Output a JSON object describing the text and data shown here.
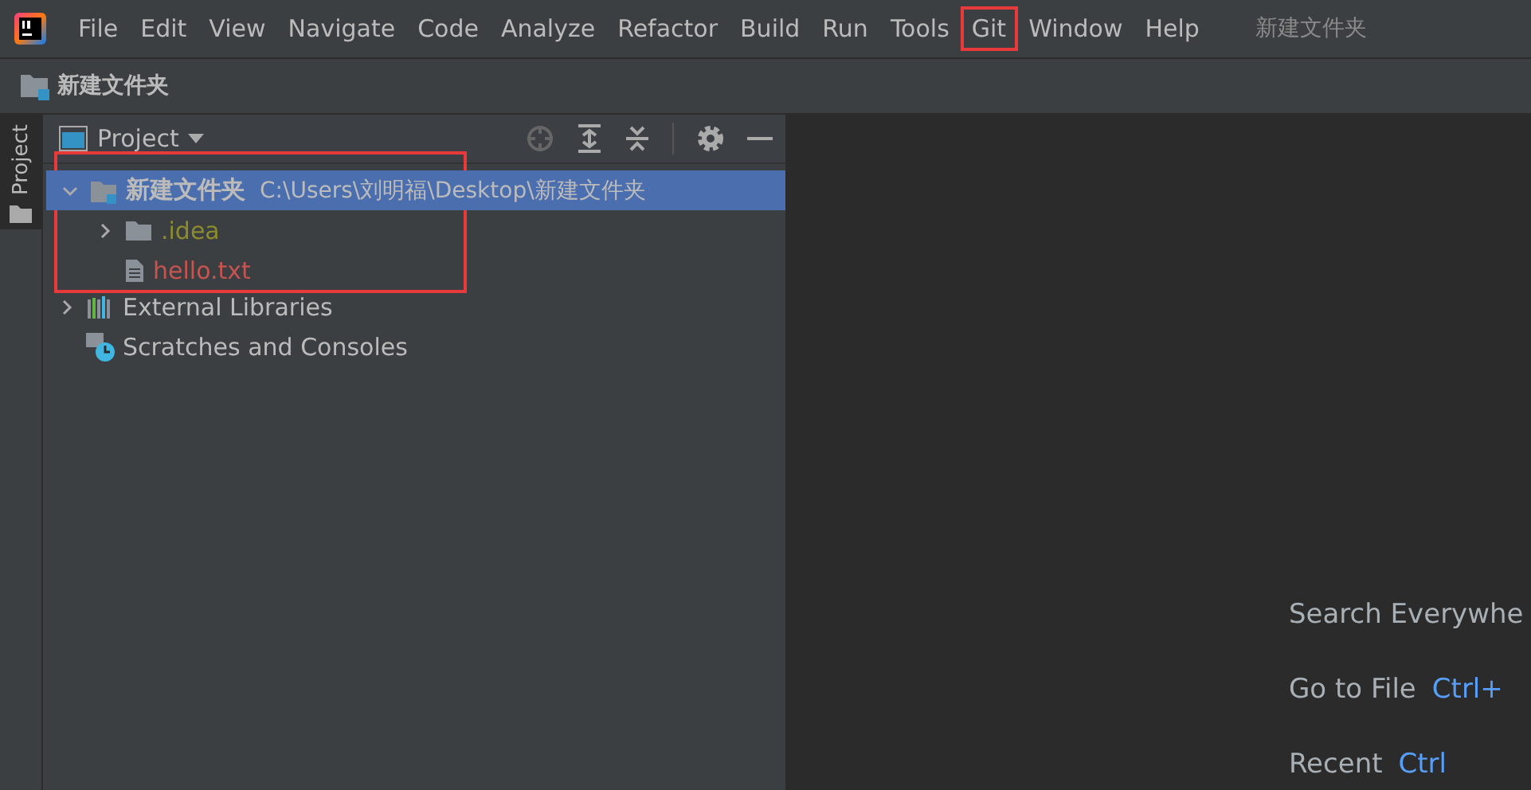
{
  "menu_bar": {
    "items": [
      {
        "label": "File",
        "highlighted": false
      },
      {
        "label": "Edit",
        "highlighted": false
      },
      {
        "label": "View",
        "highlighted": false
      },
      {
        "label": "Navigate",
        "highlighted": false
      },
      {
        "label": "Code",
        "highlighted": false
      },
      {
        "label": "Analyze",
        "highlighted": false
      },
      {
        "label": "Refactor",
        "highlighted": false
      },
      {
        "label": "Build",
        "highlighted": false
      },
      {
        "label": "Run",
        "highlighted": false
      },
      {
        "label": "Tools",
        "highlighted": false
      },
      {
        "label": "Git",
        "highlighted": true
      },
      {
        "label": "Window",
        "highlighted": false
      },
      {
        "label": "Help",
        "highlighted": false
      }
    ],
    "project_title": "新建文件夹"
  },
  "breadcrumb": "新建文件夹",
  "side_tab": {
    "label": "Project",
    "selected": true
  },
  "project_panel": {
    "title": "Project",
    "tree": [
      {
        "name": "新建文件夹",
        "path": "C:\\Users\\刘明福\\Desktop\\新建文件夹",
        "kind": "module",
        "selected": true,
        "expanded": true,
        "highlighted": true,
        "children": [
          {
            "name": ".idea",
            "kind": "folder",
            "color": "#8c8c2e",
            "selected": false,
            "expanded": false
          },
          {
            "name": "hello.txt",
            "kind": "file",
            "color": "#c75450",
            "selected": false
          }
        ]
      },
      {
        "name": "External Libraries",
        "kind": "libraries",
        "selected": false,
        "expanded": false
      },
      {
        "name": "Scratches and Consoles",
        "kind": "scratches",
        "selected": false
      }
    ]
  },
  "editor_hints": [
    {
      "action": "Search Everywhe"
    },
    {
      "action": "Go to File",
      "shortcut": "Ctrl+"
    },
    {
      "action": "Recent",
      "shortcut": "Ctrl"
    }
  ]
}
